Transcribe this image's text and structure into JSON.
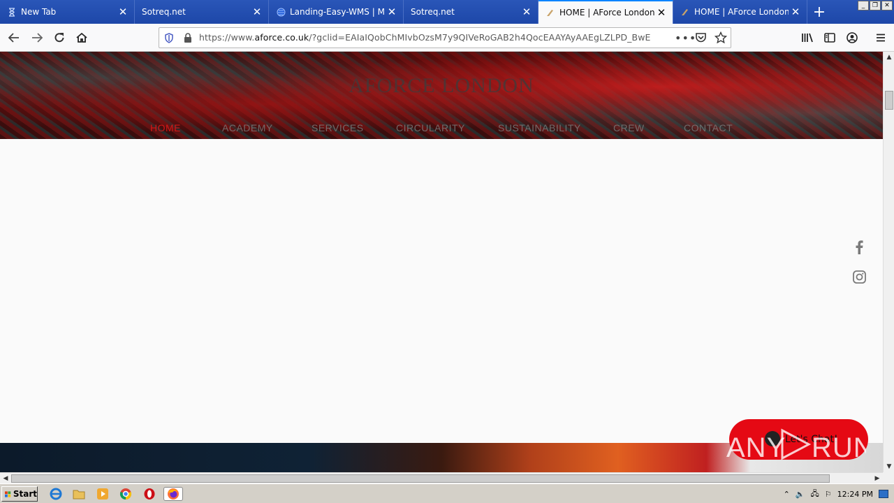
{
  "browser": {
    "tabs": [
      {
        "title": "New Tab",
        "icon": "hourglass-icon",
        "active": false
      },
      {
        "title": "Sotreq.net",
        "icon": "",
        "active": false
      },
      {
        "title": "Landing-Easy-WMS | Mecal",
        "icon": "globe-icon",
        "active": false
      },
      {
        "title": "Sotreq.net",
        "icon": "",
        "active": false
      },
      {
        "title": "HOME | AForce London",
        "icon": "aforce-icon",
        "active": true
      },
      {
        "title": "HOME | AForce London",
        "icon": "aforce-icon",
        "active": false
      }
    ],
    "url_prefix": "https://www.",
    "url_domain": "aforce.co.uk",
    "url_rest": "/?gclid=EAIaIQobChMIvbOzsM7y9QIVeRoGAB2h4QocEAAYAyAAEgLZLPD_BwE",
    "close_glyph": "✕",
    "new_tab_glyph": "+"
  },
  "site": {
    "brand": "AFORCE LONDON",
    "menu": [
      {
        "label": "HOME",
        "current": true
      },
      {
        "label": "ACADEMY",
        "current": false
      },
      {
        "label": "SERVICES",
        "current": false
      },
      {
        "label": "CIRCULARITY",
        "current": false
      },
      {
        "label": "SUSTAINABILITY",
        "current": false
      },
      {
        "label": "CREW",
        "current": false
      },
      {
        "label": "CONTACT",
        "current": false
      }
    ],
    "chat_label": "Let's Chat!",
    "accent_color": "#e50914"
  },
  "watermark": "ANY RUN",
  "taskbar": {
    "start_label": "Start",
    "clock": "12:24 PM"
  }
}
